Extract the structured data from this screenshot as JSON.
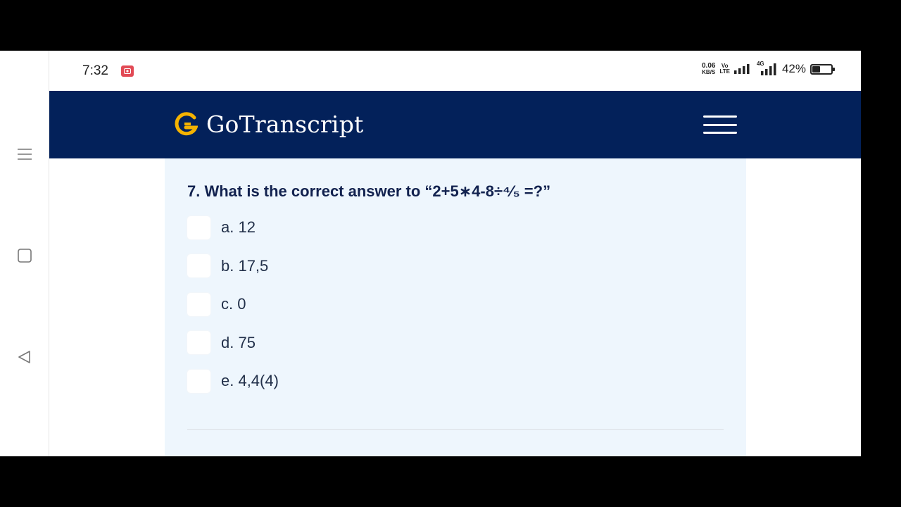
{
  "status_bar": {
    "time": "7:32",
    "net_speed_value": "0.06",
    "net_speed_unit": "KB/S",
    "volte_top": "Vo",
    "volte_bottom": "LTE",
    "network_type": "4G",
    "battery_percent": "42%",
    "battery_level": 0.42
  },
  "header": {
    "brand": "GoTranscript",
    "brand_color": "#03215a",
    "logo_accent": "#f5b301"
  },
  "quiz": {
    "question": "7. What is the correct answer to “2+5∗4-8÷⁴⁄₅ =?”",
    "options": [
      {
        "label": "a. 12"
      },
      {
        "label": "b. 17,5"
      },
      {
        "label": "c. 0"
      },
      {
        "label": "d. 75"
      },
      {
        "label": "e. 4,4(4)"
      }
    ]
  },
  "icons": {
    "nav_menu": "menu-lines-icon",
    "nav_home": "square-icon",
    "nav_back": "triangle-back-icon",
    "recording": "screen-record-icon",
    "hamburger": "hamburger-icon"
  }
}
